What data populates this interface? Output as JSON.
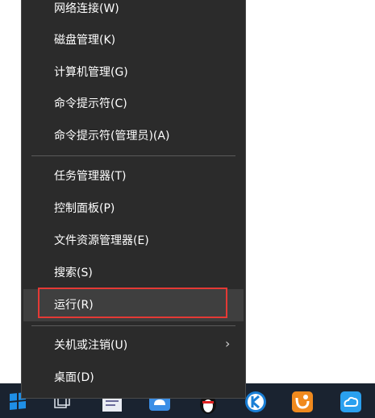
{
  "menu": {
    "items": [
      {
        "label": "网络连接(W)"
      },
      {
        "label": "磁盘管理(K)"
      },
      {
        "label": "计算机管理(G)"
      },
      {
        "label": "命令提示符(C)"
      },
      {
        "label": "命令提示符(管理员)(A)"
      },
      {
        "label": "任务管理器(T)"
      },
      {
        "label": "控制面板(P)"
      },
      {
        "label": "文件资源管理器(E)"
      },
      {
        "label": "搜索(S)"
      },
      {
        "label": "运行(R)"
      },
      {
        "label": "关机或注销(U)"
      },
      {
        "label": "桌面(D)"
      }
    ],
    "submenu_indicator": "›"
  },
  "colors": {
    "menu_bg": "#2b2b2b",
    "highlight": "#e53935",
    "taskbar_bg": "#1a2330",
    "windows_blue": "#1f8fe6"
  }
}
